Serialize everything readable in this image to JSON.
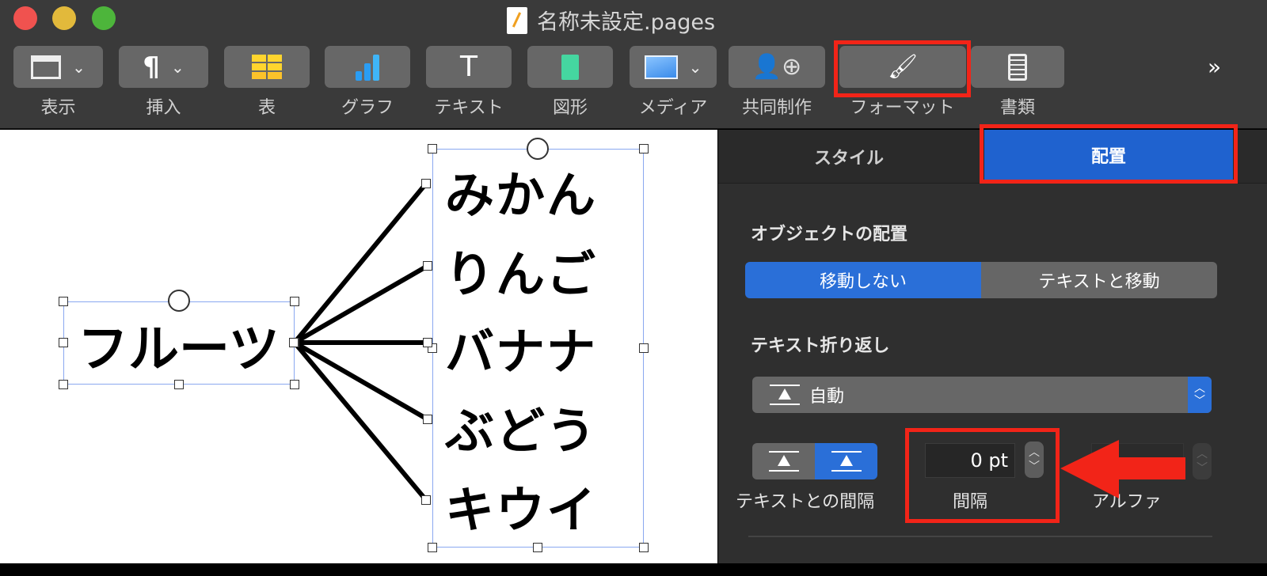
{
  "window": {
    "title": "名称未設定.pages",
    "traffic_lights": {
      "close": "#f0524f",
      "minimize": "#e2b93b",
      "zoom": "#4db53b"
    }
  },
  "toolbar": {
    "items": [
      {
        "label": "表示",
        "icon": "view-layout-icon",
        "dropdown": true
      },
      {
        "label": "挿入",
        "icon": "pilcrow-icon",
        "dropdown": true
      },
      {
        "label": "表",
        "icon": "table-icon"
      },
      {
        "label": "グラフ",
        "icon": "chart-icon"
      },
      {
        "label": "テキスト",
        "icon": "text-icon"
      },
      {
        "label": "図形",
        "icon": "shape-icon"
      },
      {
        "label": "メディア",
        "icon": "media-icon",
        "dropdown": true
      },
      {
        "label": "共同制作",
        "icon": "collaborate-icon"
      },
      {
        "label": "フォーマット",
        "icon": "format-paintbrush-icon",
        "highlighted": true
      },
      {
        "label": "書類",
        "icon": "document-icon"
      }
    ],
    "overflow": "»"
  },
  "canvas": {
    "root": "フルーツ",
    "items": [
      "みかん",
      "りんご",
      "バナナ",
      "ぶどう",
      "キウイ"
    ]
  },
  "panel": {
    "tabs": [
      {
        "label": "スタイル",
        "active": false
      },
      {
        "label": "配置",
        "active": true
      }
    ],
    "object_placement": {
      "heading": "オブジェクトの配置",
      "options": [
        "移動しない",
        "テキストと移動"
      ],
      "selected": "移動しない"
    },
    "text_wrap": {
      "heading": "テキスト折り返し",
      "value": "自動"
    },
    "spacing": {
      "text_spacing_label": "テキストとの間隔",
      "spacing_value": "0 pt",
      "spacing_label": "間隔",
      "alpha_label": "アルファ"
    }
  },
  "colors": {
    "accent": "#2a6fd8",
    "annotation": "#f22418"
  }
}
